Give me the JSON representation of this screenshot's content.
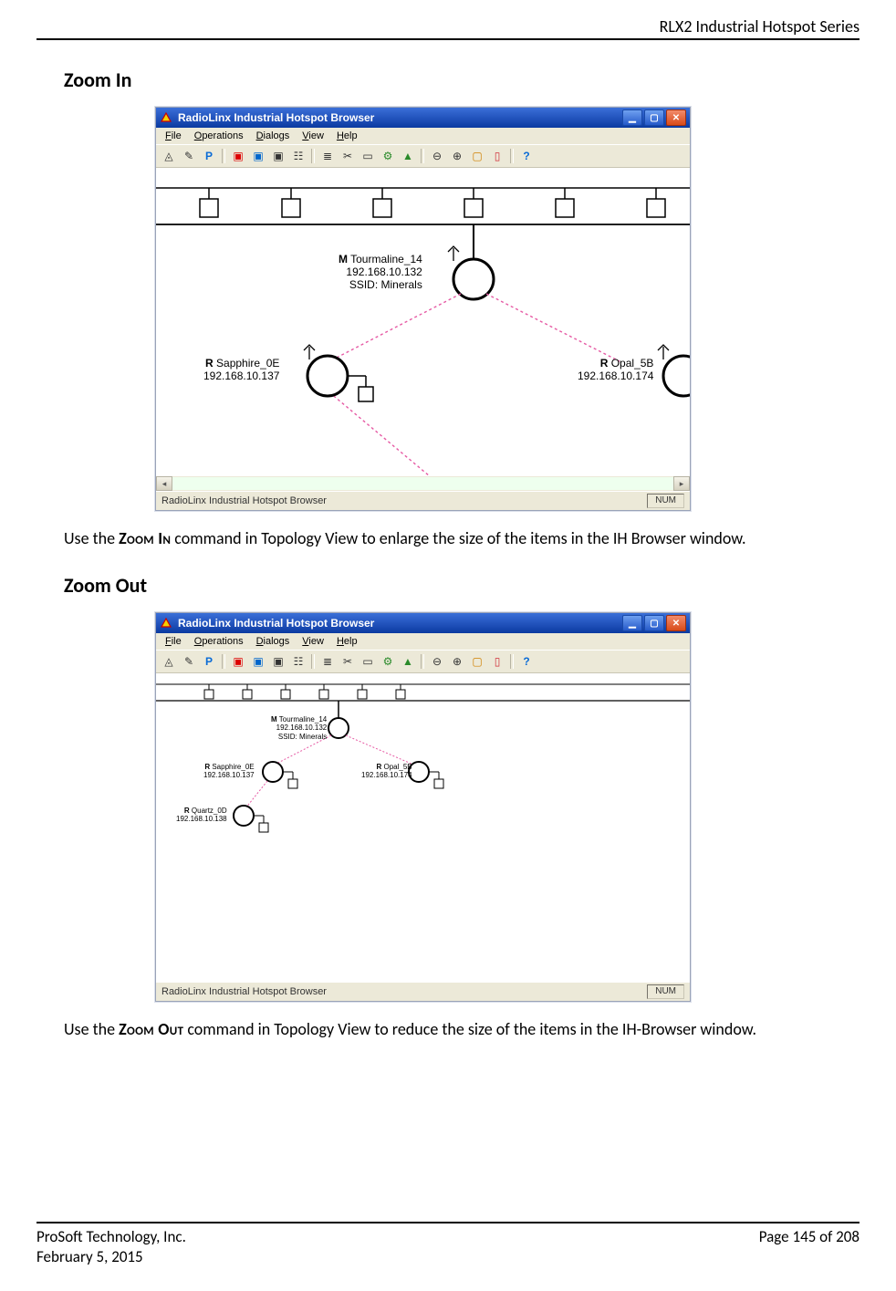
{
  "header": {
    "right": "RLX2 Industrial Hotspot Series"
  },
  "sections": {
    "zoom_in": {
      "heading": "Zoom In",
      "body_prefix": "Use the ",
      "body_cmd": "Zoom In",
      "body_suffix": " command in Topology View to enlarge the size of the items in the IH Browser window."
    },
    "zoom_out": {
      "heading": "Zoom Out",
      "body_prefix": "Use the ",
      "body_cmd": "Zoom Out",
      "body_suffix": " command in Topology View to reduce the size of the items in the IH-Browser window."
    }
  },
  "win": {
    "title": "RadioLinx Industrial Hotspot Browser",
    "menus": {
      "file": "File",
      "operations": "Operations",
      "dialogs": "Dialogs",
      "view": "View",
      "help": "Help"
    },
    "status_text": "RadioLinx Industrial Hotspot Browser",
    "status_num": "NUM"
  },
  "topology_large": {
    "master": {
      "marker": "M",
      "name": "Tourmaline_14",
      "ip": "192.168.10.132",
      "ssid": "SSID: Minerals"
    },
    "left": {
      "marker": "R",
      "name": "Sapphire_0E",
      "ip": "192.168.10.137"
    },
    "right": {
      "marker": "R",
      "name": "Opal_5B",
      "ip": "192.168.10.174"
    }
  },
  "topology_small": {
    "master": {
      "marker": "M",
      "name": "Tourmaline_14",
      "ip": "192.168.10.132",
      "ssid": "SSID: Minerals"
    },
    "left": {
      "marker": "R",
      "name": "Sapphire_0E",
      "ip": "192.168.10.137"
    },
    "right": {
      "marker": "R",
      "name": "Opal_5B",
      "ip": "192.168.10.174"
    },
    "extra": {
      "marker": "R",
      "name": "Quartz_0D",
      "ip": "192.168.10.138"
    }
  },
  "footer": {
    "company": "ProSoft Technology, Inc.",
    "date": "February 5, 2015",
    "page": "Page 145 of 208"
  }
}
